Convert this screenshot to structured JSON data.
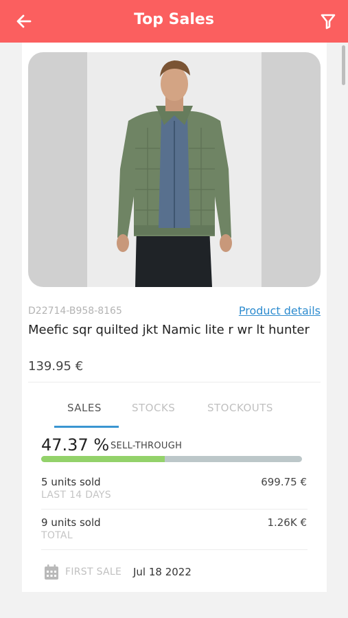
{
  "header": {
    "title": "Top Sales",
    "back_icon": "arrow-left-icon",
    "filter_icon": "filter-icon",
    "color": "#fb5f5f"
  },
  "product": {
    "sku": "D22714-B958-8165",
    "details_link": "Product details",
    "name": "Meefic sqr quilted jkt Namic lite r wr lt hunter",
    "price": "139.95 €"
  },
  "tabs": [
    {
      "label": "SALES",
      "active": true
    },
    {
      "label": "STOCKS",
      "active": false
    },
    {
      "label": "STOCKOUTS",
      "active": false
    }
  ],
  "sales": {
    "sell_through_value": "47.37 %",
    "sell_through_label": "SELL-THROUGH",
    "sell_through_fraction": 0.4737,
    "rows": [
      {
        "units": "5 units sold",
        "period": "LAST 14 DAYS",
        "amount": "699.75 €"
      },
      {
        "units": "9 units sold",
        "period": "TOTAL",
        "amount": "1.26K €"
      }
    ],
    "first_sale_label": "FIRST SALE",
    "first_sale_date": "Jul 18 2022",
    "calendar_icon": "calendar-icon"
  },
  "colors": {
    "accent": "#3a95d1",
    "progress_fill": "#93d26a",
    "progress_track": "#bcc7c9"
  }
}
